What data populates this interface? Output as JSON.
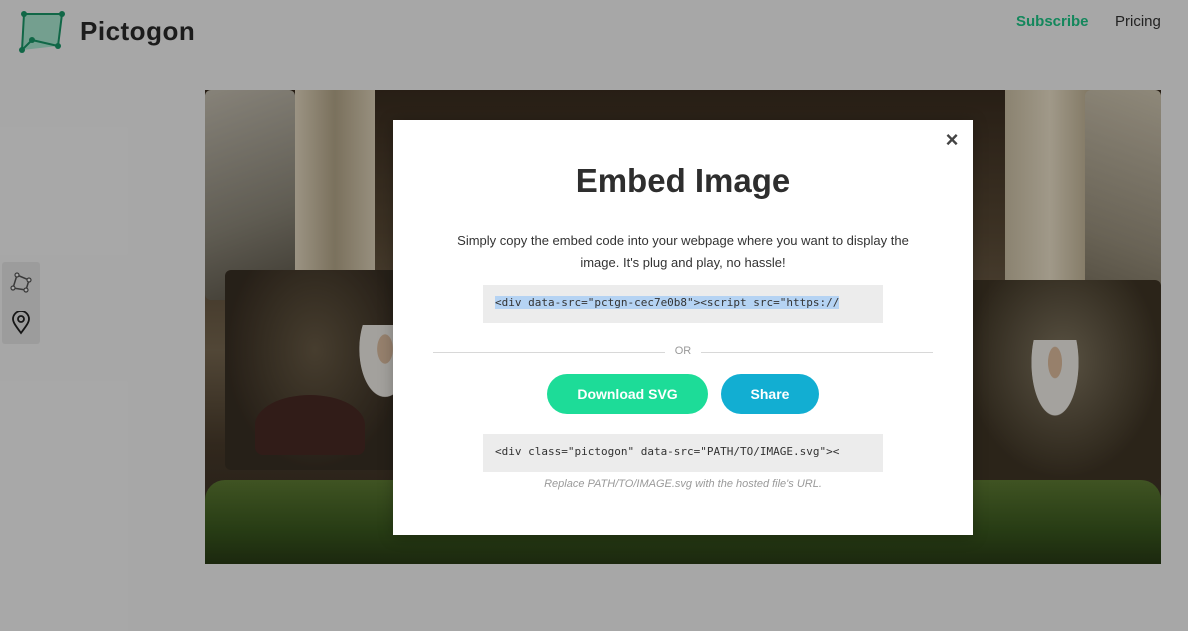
{
  "header": {
    "brand": "Pictogon",
    "nav": {
      "subscribe": "Subscribe",
      "pricing": "Pricing"
    }
  },
  "tools": {
    "items": [
      {
        "icon": "polygon-icon"
      },
      {
        "icon": "map-pin-icon"
      }
    ]
  },
  "modal": {
    "title": "Embed Image",
    "description": "Simply copy the embed code into your webpage where you want to display the image. It's plug and play, no hassle!",
    "embed_code": "<div data-src=\"pctgn-cec7e0b8\"><script src=\"https://",
    "or_label": "OR",
    "download_label": "Download SVG",
    "share_label": "Share",
    "svg_code": "<div class=\"pictogon\" data-src=\"PATH/TO/IMAGE.svg\"><",
    "hint": "Replace PATH/TO/IMAGE.svg with the hosted file's URL.",
    "close_icon": "close-icon"
  },
  "colors": {
    "accent_green": "#1ddc98",
    "accent_blue": "#12aed2",
    "subscribe_green": "#1ec98a"
  }
}
